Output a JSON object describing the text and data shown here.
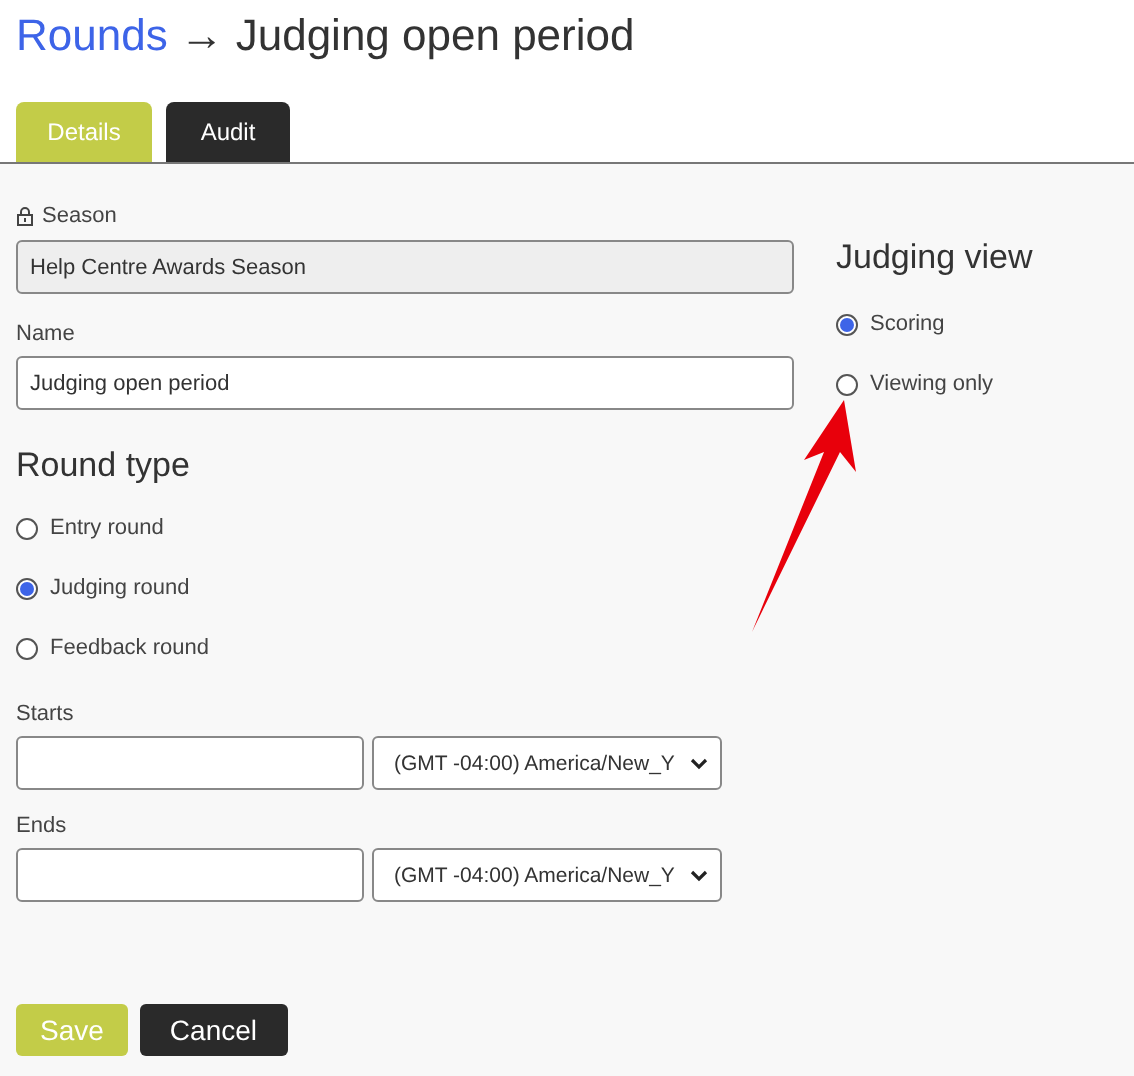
{
  "breadcrumb": {
    "link": "Rounds",
    "arrow": "→",
    "current": "Judging open period"
  },
  "tabs": [
    {
      "label": "Details",
      "selected": true
    },
    {
      "label": "Audit",
      "selected": false
    }
  ],
  "season": {
    "label": "Season",
    "value": "Help Centre Awards Season",
    "locked": true
  },
  "name": {
    "label": "Name",
    "value": "Judging open period"
  },
  "round_type": {
    "heading": "Round type",
    "options": [
      {
        "label": "Entry round",
        "selected": false
      },
      {
        "label": "Judging round",
        "selected": true
      },
      {
        "label": "Feedback round",
        "selected": false
      }
    ]
  },
  "dates": [
    {
      "label": "Starts",
      "timezone": "(GMT -04:00) America/New_Y"
    },
    {
      "label": "Ends",
      "timezone": "(GMT -04:00) America/New_Y"
    }
  ],
  "judging_view": {
    "heading": "Judging view",
    "options": [
      {
        "label": "Scoring",
        "selected": true
      },
      {
        "label": "Viewing only",
        "selected": false
      }
    ]
  },
  "buttons": [
    {
      "label": "Save",
      "kind": "primary"
    },
    {
      "label": "Cancel",
      "kind": "secondary"
    }
  ]
}
